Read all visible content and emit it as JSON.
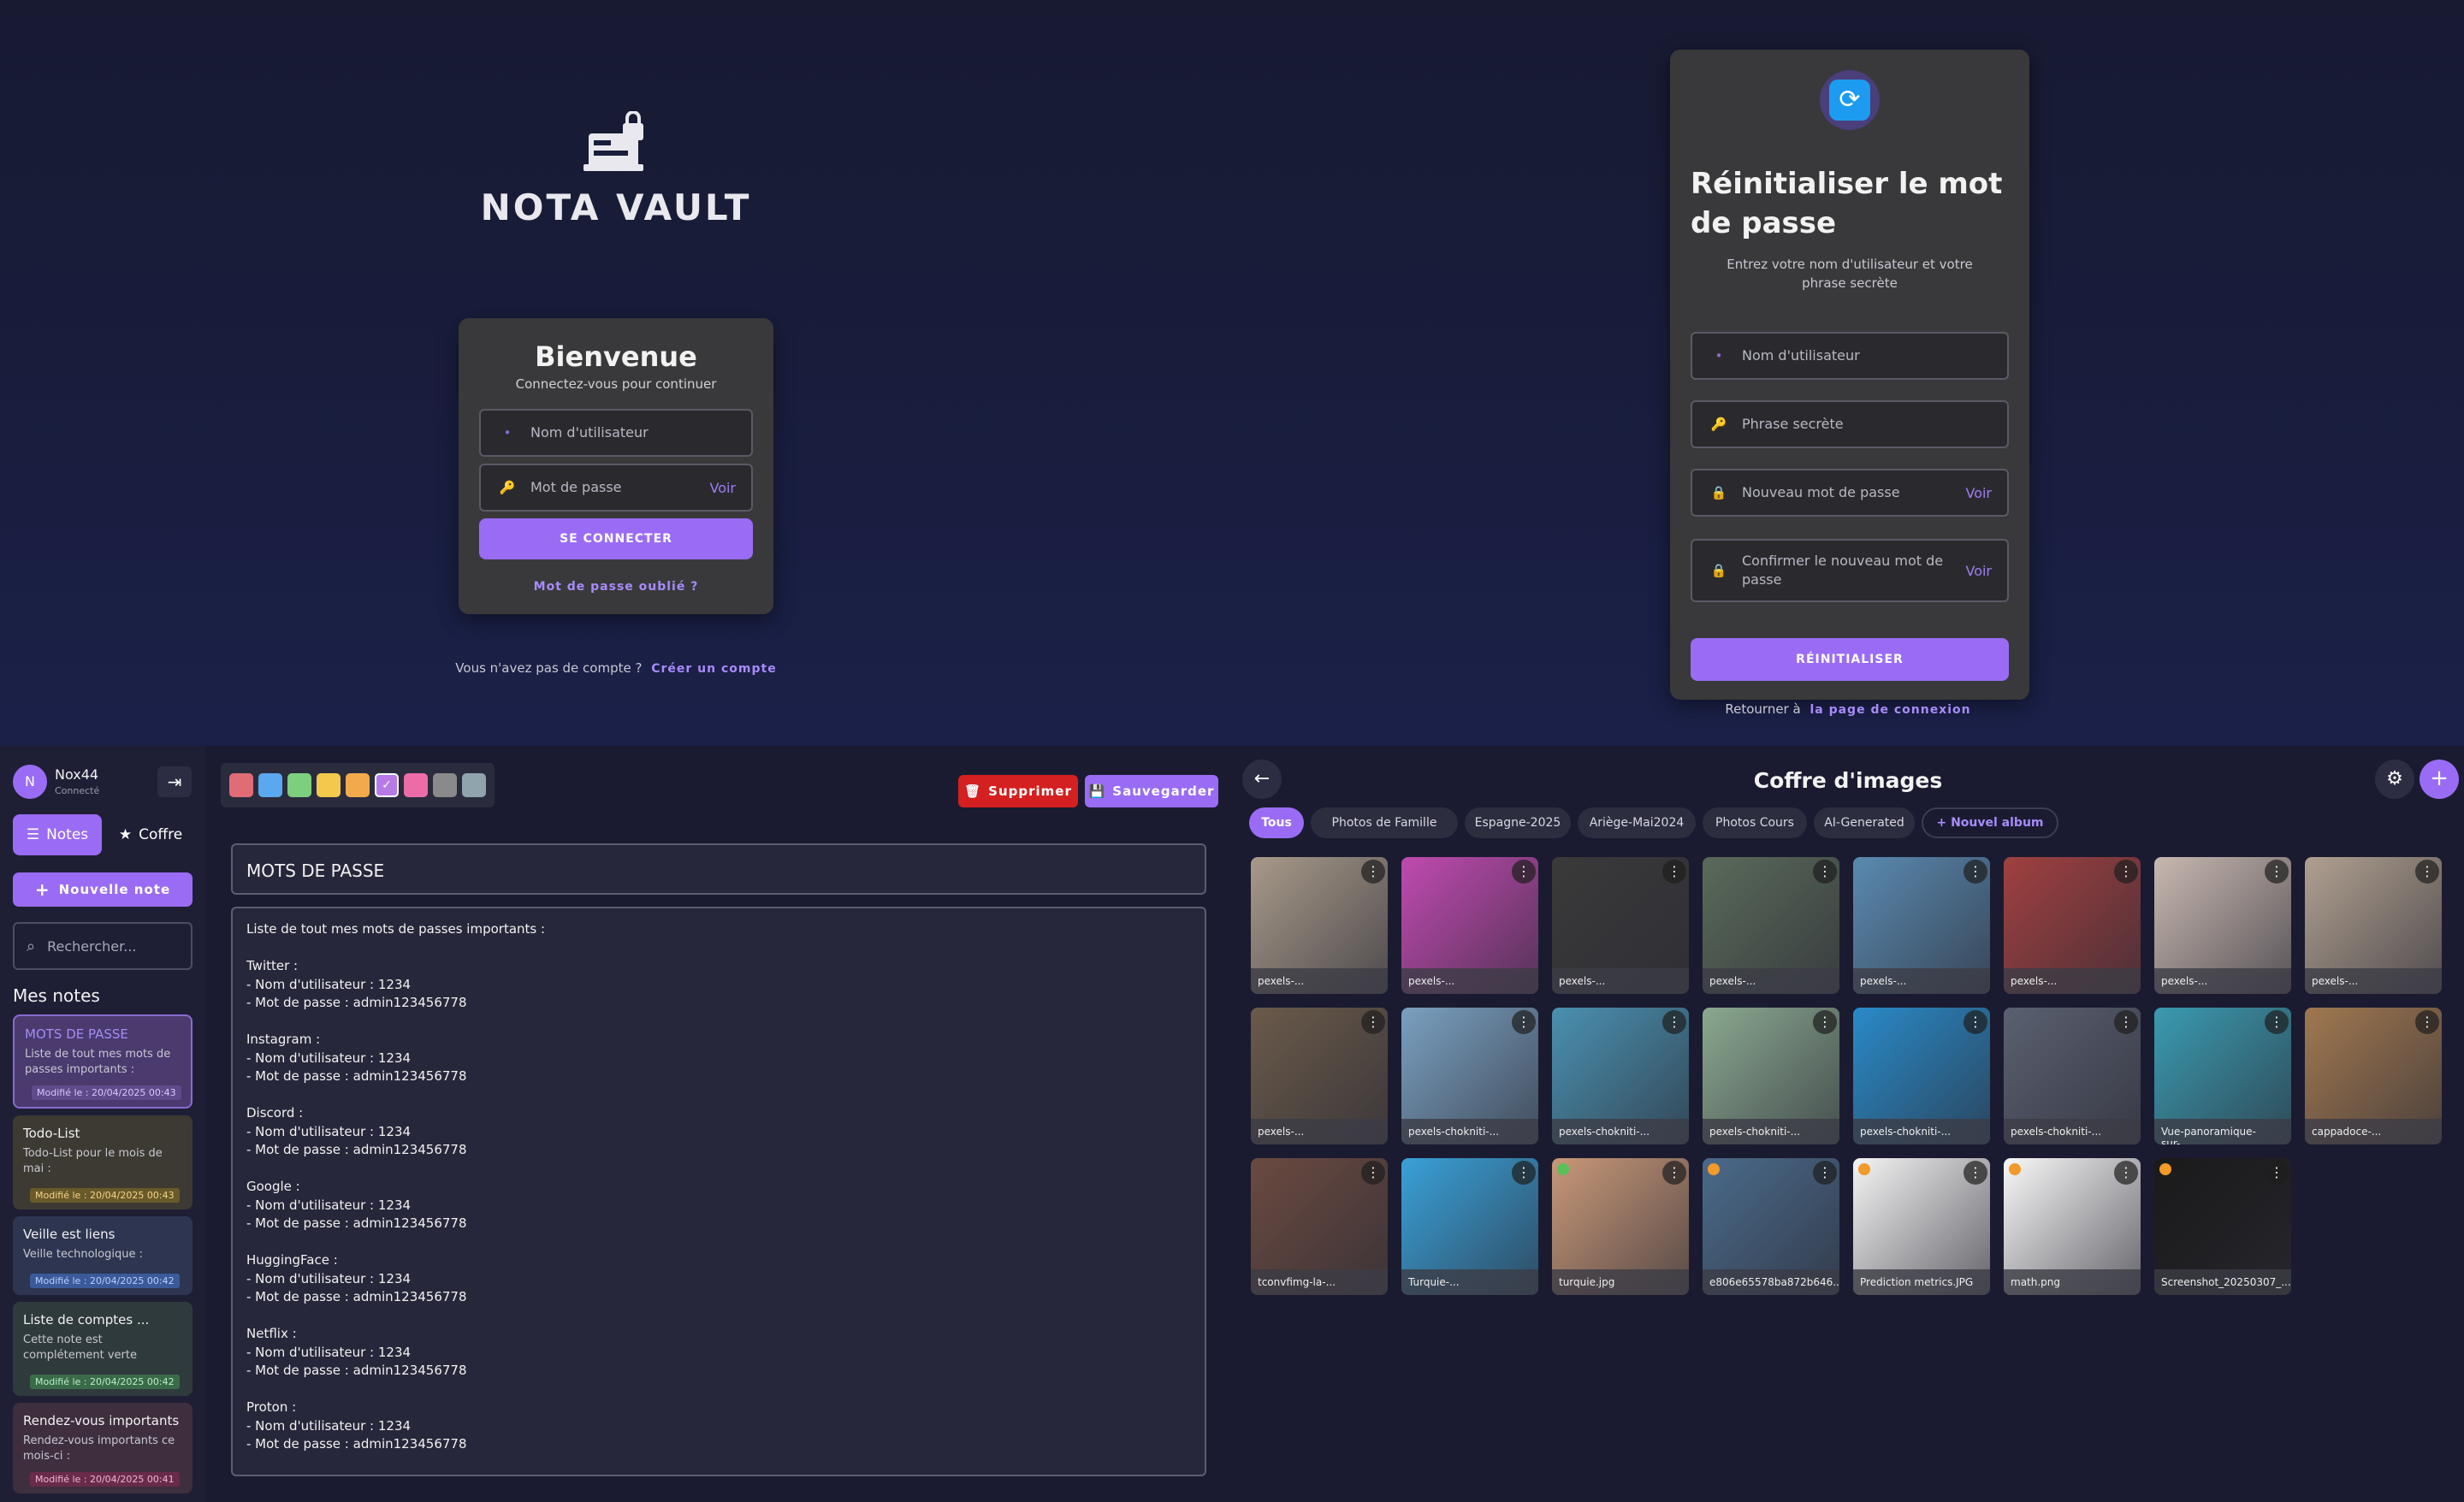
{
  "login": {
    "logo_text": "NOTA VAULT",
    "title": "Bienvenue",
    "subtitle": "Connectez-vous pour continuer",
    "username_placeholder": "Nom d'utilisateur",
    "password_placeholder": "Mot de passe",
    "show_label": "Voir",
    "submit_label": "SE CONNECTER",
    "forgot_label": "Mot de passe oublié ?",
    "no_account_text": "Vous n'avez pas de compte ?",
    "create_account_label": "Créer un compte"
  },
  "reset": {
    "title": "Réinitialiser le mot de passe",
    "subtitle": "Entrez votre nom d'utilisateur et votre phrase secrète",
    "username_placeholder": "Nom d'utilisateur",
    "phrase_placeholder": "Phrase secrète",
    "new_password_placeholder": "Nouveau mot de passe",
    "confirm_password_placeholder": "Confirmer le nouveau mot de passe",
    "show_label": "Voir",
    "submit_label": "RÉINITIALISER",
    "back_text": "Retourner à",
    "back_link_label": "la page de connexion"
  },
  "notes_app": {
    "user": {
      "avatar_letter": "N",
      "name": "Nox44",
      "status": "Connecté"
    },
    "tabs": [
      {
        "label": "Notes",
        "icon": "list-icon"
      },
      {
        "label": "Coffre",
        "icon": "star-icon"
      }
    ],
    "new_note_label": "Nouvelle note",
    "search_placeholder": "Rechercher...",
    "section_title": "Mes notes",
    "notes": [
      {
        "title": "MOTS DE PASSE",
        "desc": "Liste de tout mes mots de passes importants :",
        "modified": "Modifié le : 20/04/2025 00:43",
        "bg": "#4a3a6e",
        "accent": "#a48cf4"
      },
      {
        "title": "Todo-List",
        "desc": "Todo-List pour le mois de mai :",
        "modified": "Modifié le : 20/04/2025 00:43",
        "bg": "#3d3a33",
        "accent": "#d6a94a"
      },
      {
        "title": "Veille est liens",
        "desc": "Veille technologique :",
        "modified": "Modifié le : 20/04/2025 00:42",
        "bg": "#2d3550",
        "accent": "#5a8be0"
      },
      {
        "title": "Liste de comptes ...",
        "desc": "Cette note est complétement verte",
        "modified": "Modifié le : 20/04/2025 00:42",
        "bg": "#2f3a3c",
        "accent": "#5aa06a"
      },
      {
        "title": "Rendez-vous importants",
        "desc": "Rendez-vous importants ce mois-ci :",
        "modified": "Modifié le : 20/04/2025 00:41",
        "bg": "#3e2e3e",
        "accent": "#c25a8a"
      }
    ],
    "colors": [
      "#e06c75",
      "#5aa8f0",
      "#7ccf7c",
      "#f2c94c",
      "#f2a94c",
      "#b77be8",
      "#ec6ca8",
      "#8a8a8a",
      "#90a4ae"
    ],
    "delete_label": "Supprimer",
    "save_label": "Sauvegarder",
    "note_title": "MOTS DE PASSE",
    "note_body": "Liste de tout mes mots de passes importants :\n\nTwitter :\n- Nom d'utilisateur : 1234\n- Mot de passe : admin123456778\n\nInstagram :\n- Nom d'utilisateur : 1234\n- Mot de passe : admin123456778\n\nDiscord :\n- Nom d'utilisateur : 1234\n- Mot de passe : admin123456778\n\nGoogle :\n- Nom d'utilisateur : 1234\n- Mot de passe : admin123456778\n\nHuggingFace :\n- Nom d'utilisateur : 1234\n- Mot de passe : admin123456778\n\nNetflix :\n- Nom d'utilisateur : 1234\n- Mot de passe : admin123456778\n\nProton :\n- Nom d'utilisateur : 1234\n- Mot de passe : admin123456778"
  },
  "vault": {
    "title": "Coffre d'images",
    "albums": [
      "Tous",
      "Photos de Famille",
      "Espagne-2025",
      "Ariège-Mai2024",
      "Photos Cours",
      "AI-Generated"
    ],
    "new_album_label": "+ Nouvel album",
    "images": [
      {
        "name": "pexels-...",
        "color": "#a89a8a"
      },
      {
        "name": "pexels-...",
        "color": "#c04ab0"
      },
      {
        "name": "pexels-...",
        "color": "#3a3a3a"
      },
      {
        "name": "pexels-...",
        "color": "#5a6a5a"
      },
      {
        "name": "pexels-...",
        "color": "#5a8ab0"
      },
      {
        "name": "pexels-...",
        "color": "#a04040"
      },
      {
        "name": "pexels-...",
        "color": "#c8b8b0"
      },
      {
        "name": "pexels-...",
        "color": "#b0a090"
      },
      {
        "name": "pexels-...",
        "color": "#6a5a4a"
      },
      {
        "name": "pexels-chokniti-...",
        "color": "#7aa0c0"
      },
      {
        "name": "pexels-chokniti-...",
        "color": "#4a90b0"
      },
      {
        "name": "pexels-chokniti-...",
        "color": "#8aa890"
      },
      {
        "name": "pexels-chokniti-...",
        "color": "#2a8ac8"
      },
      {
        "name": "pexels-chokniti-...",
        "color": "#5a6070"
      },
      {
        "name": "Vue-panoramique-sur-...",
        "color": "#3a9ab0"
      },
      {
        "name": "cappadoce-...",
        "color": "#a07850"
      },
      {
        "name": "tconvfimg-la-...",
        "color": "#6a4a40"
      },
      {
        "name": "Turquie-...",
        "color": "#3aa0d8"
      },
      {
        "name": "turquie.jpg",
        "color": "#c89878"
      },
      {
        "name": "e806e65578ba872b646...",
        "color": "#4a6a8a"
      },
      {
        "name": "Prediction metrics.JPG",
        "color": "#f4f4f4"
      },
      {
        "name": "math.png",
        "color": "#f8f8f8"
      },
      {
        "name": "Screenshot_20250307_...",
        "color": "#1a1a1a"
      }
    ],
    "image_tags": [
      null,
      null,
      null,
      null,
      null,
      null,
      null,
      null,
      null,
      null,
      null,
      null,
      null,
      null,
      null,
      null,
      null,
      null,
      "#5ac05a",
      "#f29a2a",
      "#f29a2a",
      "#f29a2a",
      "#f29a2a"
    ]
  }
}
